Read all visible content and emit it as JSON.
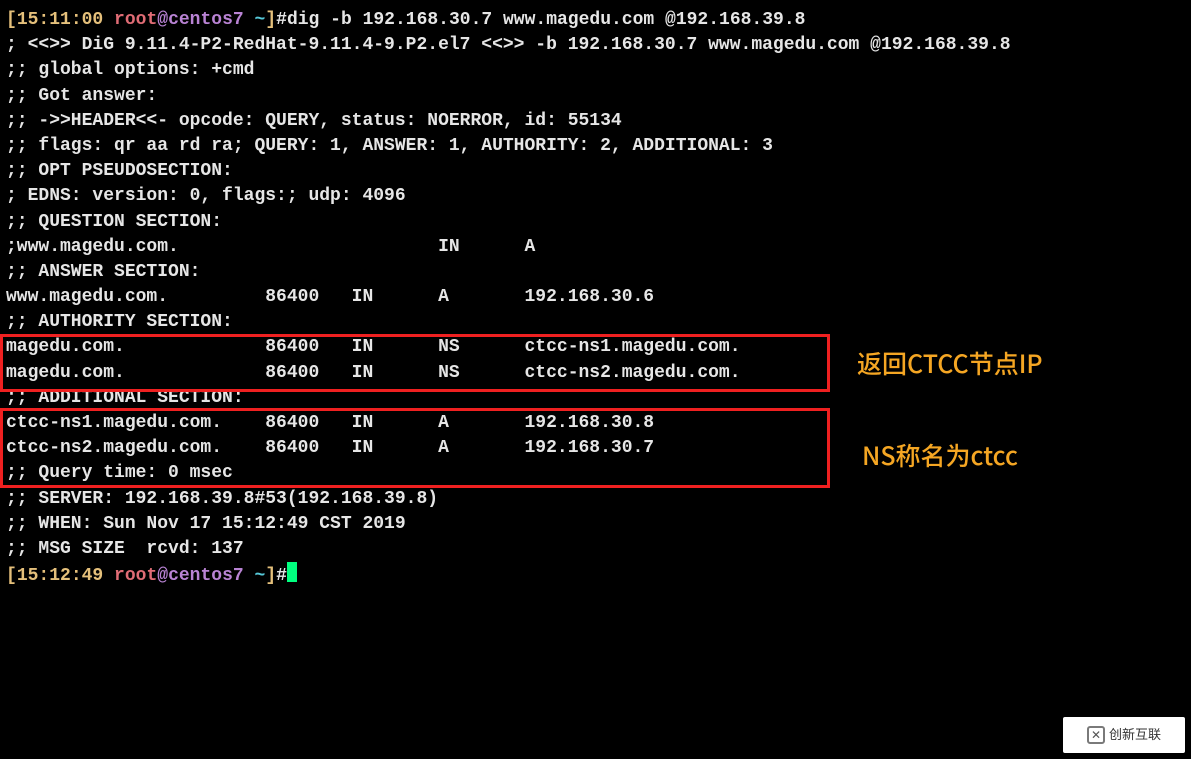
{
  "prompt1": {
    "open": "[",
    "time": "15:11:00",
    "sp1": " ",
    "user": "root",
    "at": "@",
    "host": "centos7",
    "sp2": " ",
    "path": "~",
    "close": "]",
    "hash": "#",
    "cmd": "dig -b 192.168.30.7 www.magedu.com @192.168.39.8"
  },
  "out": {
    "l01": "",
    "l02": "; <<>> DiG 9.11.4-P2-RedHat-9.11.4-9.P2.el7 <<>> -b 192.168.30.7 www.magedu.com @192.168.39.8",
    "l03": ";; global options: +cmd",
    "l04": ";; Got answer:",
    "l05": ";; ->>HEADER<<- opcode: QUERY, status: NOERROR, id: 55134",
    "l06": ";; flags: qr aa rd ra; QUERY: 1, ANSWER: 1, AUTHORITY: 2, ADDITIONAL: 3",
    "l07": "",
    "l08": ";; OPT PSEUDOSECTION:",
    "l09": "; EDNS: version: 0, flags:; udp: 4096",
    "l10": ";; QUESTION SECTION:",
    "l11": ";www.magedu.com.                        IN      A",
    "l12": "",
    "l13": ";; ANSWER SECTION:",
    "l14": "www.magedu.com.         86400   IN      A       192.168.30.6",
    "l15": "",
    "l16": ";; AUTHORITY SECTION:",
    "l17": "magedu.com.             86400   IN      NS      ctcc-ns1.magedu.com.",
    "l18": "magedu.com.             86400   IN      NS      ctcc-ns2.magedu.com.",
    "l19": "",
    "l20": ";; ADDITIONAL SECTION:",
    "l21": "ctcc-ns1.magedu.com.    86400   IN      A       192.168.30.8",
    "l22": "ctcc-ns2.magedu.com.    86400   IN      A       192.168.30.7",
    "l23": "",
    "l24": ";; Query time: 0 msec",
    "l25": ";; SERVER: 192.168.39.8#53(192.168.39.8)",
    "l26": ";; WHEN: Sun Nov 17 15:12:49 CST 2019",
    "l27": ";; MSG SIZE  rcvd: 137",
    "l28": ""
  },
  "prompt2": {
    "open": "[",
    "time": "15:12:49",
    "sp1": " ",
    "user": "root",
    "at": "@",
    "host": "centos7",
    "sp2": " ",
    "path": "~",
    "close": "]",
    "hash": "#"
  },
  "annotations": {
    "a1": "返回CTCC节点IP",
    "a2": "NS称名为ctcc"
  },
  "watermark": {
    "logo": "✕",
    "text": "创新互联"
  },
  "colors": {
    "yellow": "#e5c07b",
    "red": "#e06c75",
    "purple": "#b983d4",
    "cyan": "#56c8d8",
    "boxBorder": "#ef2020",
    "annotation": "#f5a623"
  }
}
